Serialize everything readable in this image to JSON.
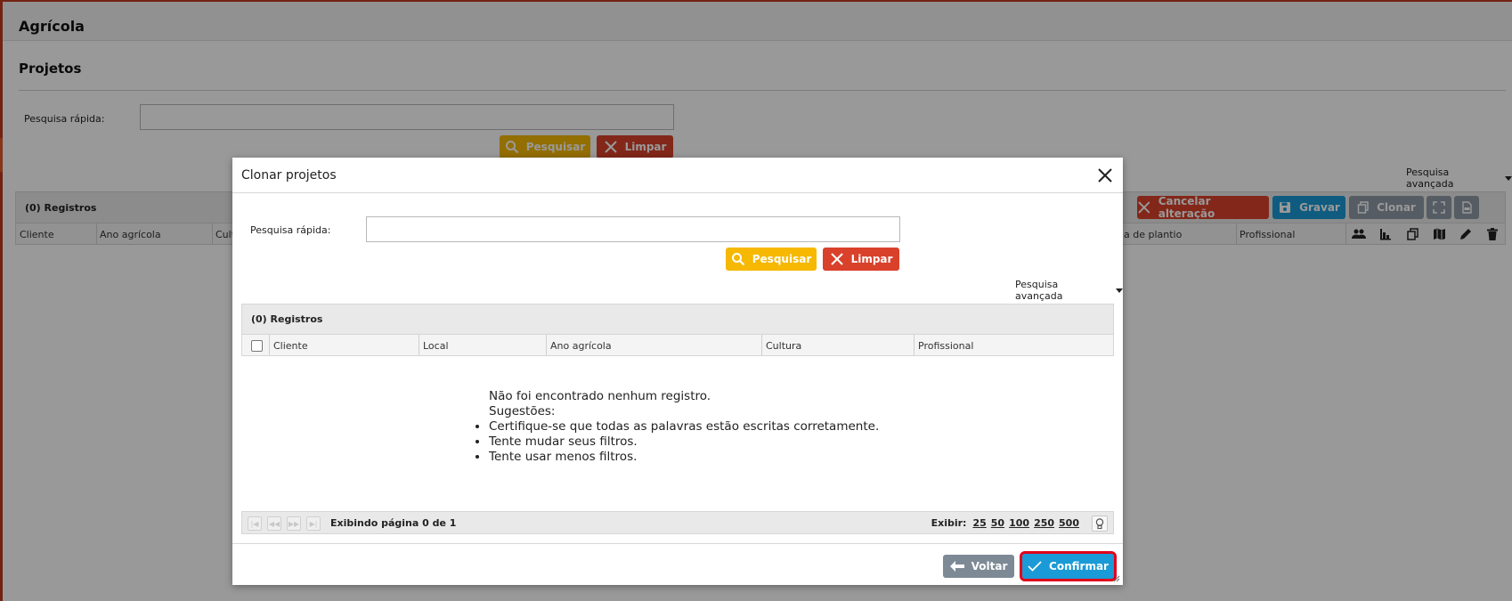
{
  "app": {
    "title": "Agrícola"
  },
  "page": {
    "title": "Projetos"
  },
  "search": {
    "label": "Pesquisa rápida:",
    "value": "",
    "search_label": "Pesquisar",
    "clear_label": "Limpar",
    "advanced_label": "Pesquisa avançada"
  },
  "grid": {
    "records_label": "(0) Registros",
    "columns_left": [
      "Cliente",
      "Ano agrícola",
      "Cult"
    ],
    "columns_right": [
      "a de plantio",
      "Profissional"
    ],
    "toolbar": {
      "cancel_label": "Cancelar alteração",
      "save_label": "Gravar",
      "clone_label": "Clonar"
    }
  },
  "modal": {
    "title": "Clonar projetos",
    "search": {
      "label": "Pesquisa rápida:",
      "value": "",
      "search_label": "Pesquisar",
      "clear_label": "Limpar",
      "advanced_label": "Pesquisa avançada"
    },
    "records_label": "(0) Registros",
    "columns": [
      "Cliente",
      "Local",
      "Ano agrícola",
      "Cultura",
      "Profissional"
    ],
    "empty": {
      "message": "Não foi encontrado nenhum registro.",
      "suggestions_label": "Sugestões:",
      "suggestions": [
        "Certifique-se que todas as palavras estão escritas corretamente.",
        "Tente mudar seus filtros.",
        "Tente usar menos filtros."
      ]
    },
    "pager": {
      "status": "Exibindo página 0 de 1",
      "show_label": "Exibir:",
      "sizes": [
        "25",
        "50",
        "100",
        "250",
        "500"
      ]
    },
    "back_label": "Voltar",
    "confirm_label": "Confirmar"
  },
  "colors": {
    "accent_red": "#d9412b",
    "accent_yellow": "#f6b800",
    "accent_blue": "#1a9ad6",
    "highlight": "#e0001b"
  }
}
